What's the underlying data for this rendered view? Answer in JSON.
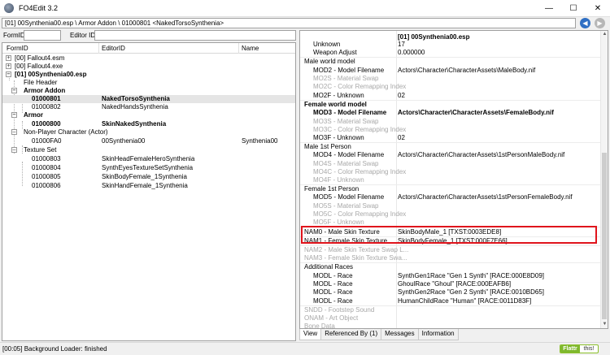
{
  "window": {
    "title": "FO4Edit 3.2"
  },
  "path": {
    "text": "[01] 00Synthenia00.esp \\ Armor Addon \\ 01000801 <NakedTorsoSynthenia>"
  },
  "filter": {
    "formid_label": "FormID",
    "editorid_label": "Editor ID",
    "formid_value": "",
    "editorid_value": ""
  },
  "tree": {
    "columns": [
      "FormID",
      "EditorID",
      "Name"
    ],
    "rows": [
      {
        "formid": "[00] Fallout4.esm",
        "editorid": "",
        "name": ""
      },
      {
        "formid": "[00] Fallout4.exe",
        "editorid": "",
        "name": ""
      },
      {
        "formid": "[01] 00Synthenia00.esp",
        "editorid": "",
        "name": ""
      },
      {
        "formid": "File Header",
        "editorid": "",
        "name": ""
      },
      {
        "formid": "Armor Addon",
        "editorid": "",
        "name": ""
      },
      {
        "formid": "01000801",
        "editorid": "NakedTorsoSynthenia",
        "name": ""
      },
      {
        "formid": "01000802",
        "editorid": "NakedHandsSynthenia",
        "name": ""
      },
      {
        "formid": "Armor",
        "editorid": "",
        "name": ""
      },
      {
        "formid": "01000800",
        "editorid": "SkinNakedSynthenia",
        "name": ""
      },
      {
        "formid": "Non-Player Character (Actor)",
        "editorid": "",
        "name": ""
      },
      {
        "formid": "01000FA0",
        "editorid": "00Synthenia00",
        "name": "Synthenia00"
      },
      {
        "formid": "Texture Set",
        "editorid": "",
        "name": ""
      },
      {
        "formid": "01000803",
        "editorid": "SkinHeadFemaleHeroSynthenia",
        "name": ""
      },
      {
        "formid": "01000804",
        "editorid": "SynthEyesTextureSetSynthenia",
        "name": ""
      },
      {
        "formid": "01000805",
        "editorid": "SkinBodyFemale_1Synthenia",
        "name": ""
      },
      {
        "formid": "01000806",
        "editorid": "SkinHandFemale_1Synthenia",
        "name": ""
      }
    ]
  },
  "record": {
    "rows": [
      {
        "label": "",
        "value": "[01] 00Synthenia00.esp"
      },
      {
        "label": "Unknown",
        "value": "17"
      },
      {
        "label": "Weapon Adjust",
        "value": "0.000000"
      },
      {
        "label": "Male world model",
        "value": ""
      },
      {
        "label": "MOD2 - Model Filename",
        "value": "Actors\\Character\\CharacterAssets\\MaleBody.nif"
      },
      {
        "label": "MO2S - Material Swap",
        "value": ""
      },
      {
        "label": "MO2C - Color Remapping Index",
        "value": ""
      },
      {
        "label": "MO2F - Unknown",
        "value": "02"
      },
      {
        "label": "Female world model",
        "value": ""
      },
      {
        "label": "MOD3 - Model Filename",
        "value": "Actors\\Character\\CharacterAssets\\FemaleBody.nif"
      },
      {
        "label": "MO3S - Material Swap",
        "value": ""
      },
      {
        "label": "MO3C - Color Remapping Index",
        "value": ""
      },
      {
        "label": "MO3F - Unknown",
        "value": "02"
      },
      {
        "label": "Male 1st Person",
        "value": ""
      },
      {
        "label": "MOD4 - Model Filename",
        "value": "Actors\\Character\\CharacterAssets\\1stPersonMaleBody.nif"
      },
      {
        "label": "MO4S - Material Swap",
        "value": ""
      },
      {
        "label": "MO4C - Color Remapping Index",
        "value": ""
      },
      {
        "label": "MO4F - Unknown",
        "value": ""
      },
      {
        "label": "Female 1st Person",
        "value": ""
      },
      {
        "label": "MOD5 - Model Filename",
        "value": "Actors\\Character\\CharacterAssets\\1stPersonFemaleBody.nif"
      },
      {
        "label": "MO5S - Material Swap",
        "value": ""
      },
      {
        "label": "MO5C - Color Remapping Index",
        "value": ""
      },
      {
        "label": "MO5F - Unknown",
        "value": ""
      },
      {
        "label": "NAM0 - Male Skin Texture",
        "value": "SkinBodyMale_1 [TXST:0003EDE8]"
      },
      {
        "label": "NAM1 - Female Skin Texture",
        "value": "SkinBodyFemale_1 [TXST:000F7E66]"
      },
      {
        "label": "NAM2 - Male Skin Texture Swap L...",
        "value": ""
      },
      {
        "label": "NAM3 - Female Skin Texture Swa...",
        "value": ""
      },
      {
        "label": "Additional Races",
        "value": ""
      },
      {
        "label": "MODL - Race",
        "value": "SynthGen1Race \"Gen 1 Synth\" [RACE:000E8D09]"
      },
      {
        "label": "MODL - Race",
        "value": "GhoulRace \"Ghoul\" [RACE:000EAFB6]"
      },
      {
        "label": "MODL - Race",
        "value": "SynthGen2Race \"Gen 2 Synth\" [RACE:0010BD65]"
      },
      {
        "label": "MODL - Race",
        "value": "HumanChildRace \"Human\" [RACE:0011D83F]"
      },
      {
        "label": "SNDD - Footstep Sound",
        "value": ""
      },
      {
        "label": "ONAM - Art Object",
        "value": ""
      },
      {
        "label": "Bone Data",
        "value": ""
      }
    ]
  },
  "tabs": [
    {
      "label": "View"
    },
    {
      "label": "Referenced By (1)"
    },
    {
      "label": "Messages"
    },
    {
      "label": "Information"
    }
  ],
  "status": {
    "text": "[00:05] Background Loader: finished",
    "flattr_label": "Flattr",
    "flattr_this": "this!"
  },
  "colors": {
    "highlight": "#e0141c",
    "accent": "#2f6fc4"
  },
  "icons": {
    "app": "fo4edit-app-icon",
    "back": "back-arrow-icon",
    "forward": "forward-arrow-icon"
  }
}
